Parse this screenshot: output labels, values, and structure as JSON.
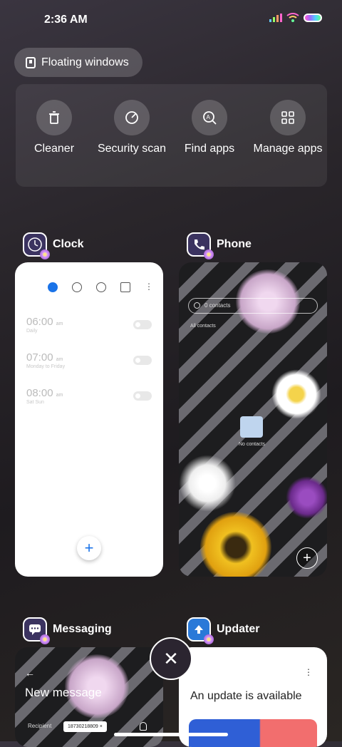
{
  "status": {
    "time": "2:36 AM"
  },
  "floating": {
    "label": "Floating windows"
  },
  "quick": [
    {
      "label": "Cleaner",
      "icon": "trash-icon"
    },
    {
      "label": "Security scan",
      "icon": "speedometer-icon"
    },
    {
      "label": "Find apps",
      "icon": "search-app-icon"
    },
    {
      "label": "Manage apps",
      "icon": "grid-icon"
    }
  ],
  "cards": {
    "clock": {
      "title": "Clock",
      "alarms": [
        {
          "time": "06:00",
          "ampm": "am",
          "days": "Daily"
        },
        {
          "time": "07:00",
          "ampm": "am",
          "days": "Monday to Friday"
        },
        {
          "time": "08:00",
          "ampm": "am",
          "days": "Sat Sun"
        }
      ]
    },
    "phone": {
      "title": "Phone",
      "search_placeholder": "0 contacts",
      "filter": "All contacts",
      "empty": "No contacts"
    },
    "messaging": {
      "title": "Messaging",
      "heading": "New message",
      "recipient_label": "Recipient",
      "recipient": "18730218809"
    },
    "updater": {
      "title": "Updater",
      "heading": "An update is available"
    }
  },
  "colors": {
    "accent": "#1a73e8"
  }
}
